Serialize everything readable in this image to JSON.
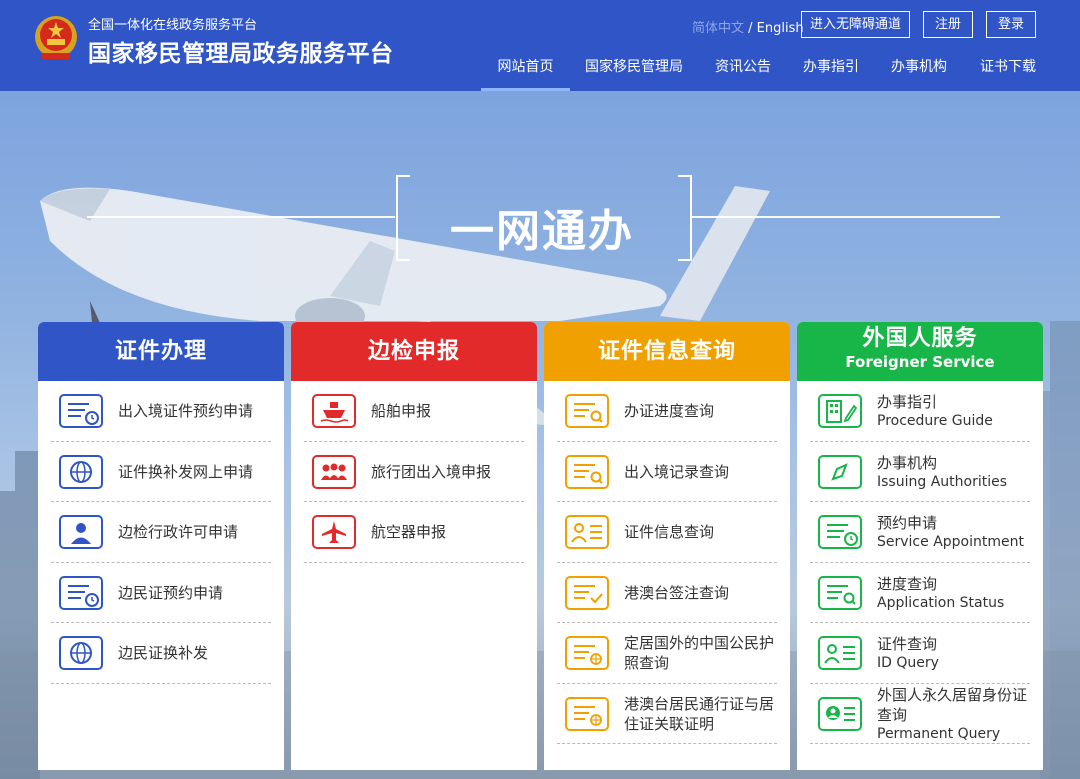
{
  "header": {
    "subtitle": "全国一体化在线政务服务平台",
    "title": "国家移民管理局政务服务平台",
    "lang_current": "简体中文",
    "lang_sep": " / ",
    "lang_other": "English",
    "accessibility_label": "进入无障碍通道",
    "register_label": "注册",
    "login_label": "登录",
    "nav": [
      "网站首页",
      "国家移民管理局",
      "资讯公告",
      "办事指引",
      "办事机构",
      "证书下载"
    ]
  },
  "hero": {
    "slogan": "一网通办"
  },
  "colors": {
    "header_bg": "#2f55c6",
    "blue": "#2f55c6",
    "red": "#e22a2a",
    "orange": "#f0a000",
    "green": "#18b549"
  },
  "cards": [
    {
      "title": "证件办理",
      "items": [
        {
          "label": "出入境证件预约申请",
          "icon": "calendar-icon"
        },
        {
          "label": "证件换补发网上申请",
          "icon": "globe-icon"
        },
        {
          "label": "边检行政许可申请",
          "icon": "officer-icon"
        },
        {
          "label": "边民证预约申请",
          "icon": "calendar-icon"
        },
        {
          "label": "边民证换补发",
          "icon": "globe-icon"
        }
      ]
    },
    {
      "title": "边检申报",
      "items": [
        {
          "label": "船舶申报",
          "icon": "ship-icon"
        },
        {
          "label": "旅行团出入境申报",
          "icon": "group-icon"
        },
        {
          "label": "航空器申报",
          "icon": "airplane-icon"
        }
      ]
    },
    {
      "title": "证件信息查询",
      "items": [
        {
          "label": "办证进度查询",
          "icon": "search-doc-icon"
        },
        {
          "label": "出入境记录查询",
          "icon": "search-doc-icon"
        },
        {
          "label": "证件信息查询",
          "icon": "person-card-icon"
        },
        {
          "label": "港澳台签注查询",
          "icon": "check-doc-icon"
        },
        {
          "label": "定居国外的中国公民护照查询",
          "icon": "globe-doc-icon"
        },
        {
          "label": "港澳台居民通行证与居住证关联证明",
          "icon": "globe-doc-icon"
        }
      ]
    },
    {
      "title": "外国人服务",
      "title_en": "Foreigner Service",
      "items": [
        {
          "label": "办事指引",
          "en": "Procedure Guide",
          "icon": "building-pen-icon"
        },
        {
          "label": "办事机构",
          "en": "Issuing Authorities",
          "icon": "compass-icon"
        },
        {
          "label": "预约申请",
          "en": "Service Appointment",
          "icon": "calendar-icon"
        },
        {
          "label": "进度查询",
          "en": "Application Status",
          "icon": "search-doc-icon"
        },
        {
          "label": "证件查询",
          "en": "ID Query",
          "icon": "person-card-icon"
        },
        {
          "label": "外国人永久居留身份证查询",
          "en": "Permanent Query",
          "icon": "id-card-icon"
        }
      ]
    }
  ]
}
